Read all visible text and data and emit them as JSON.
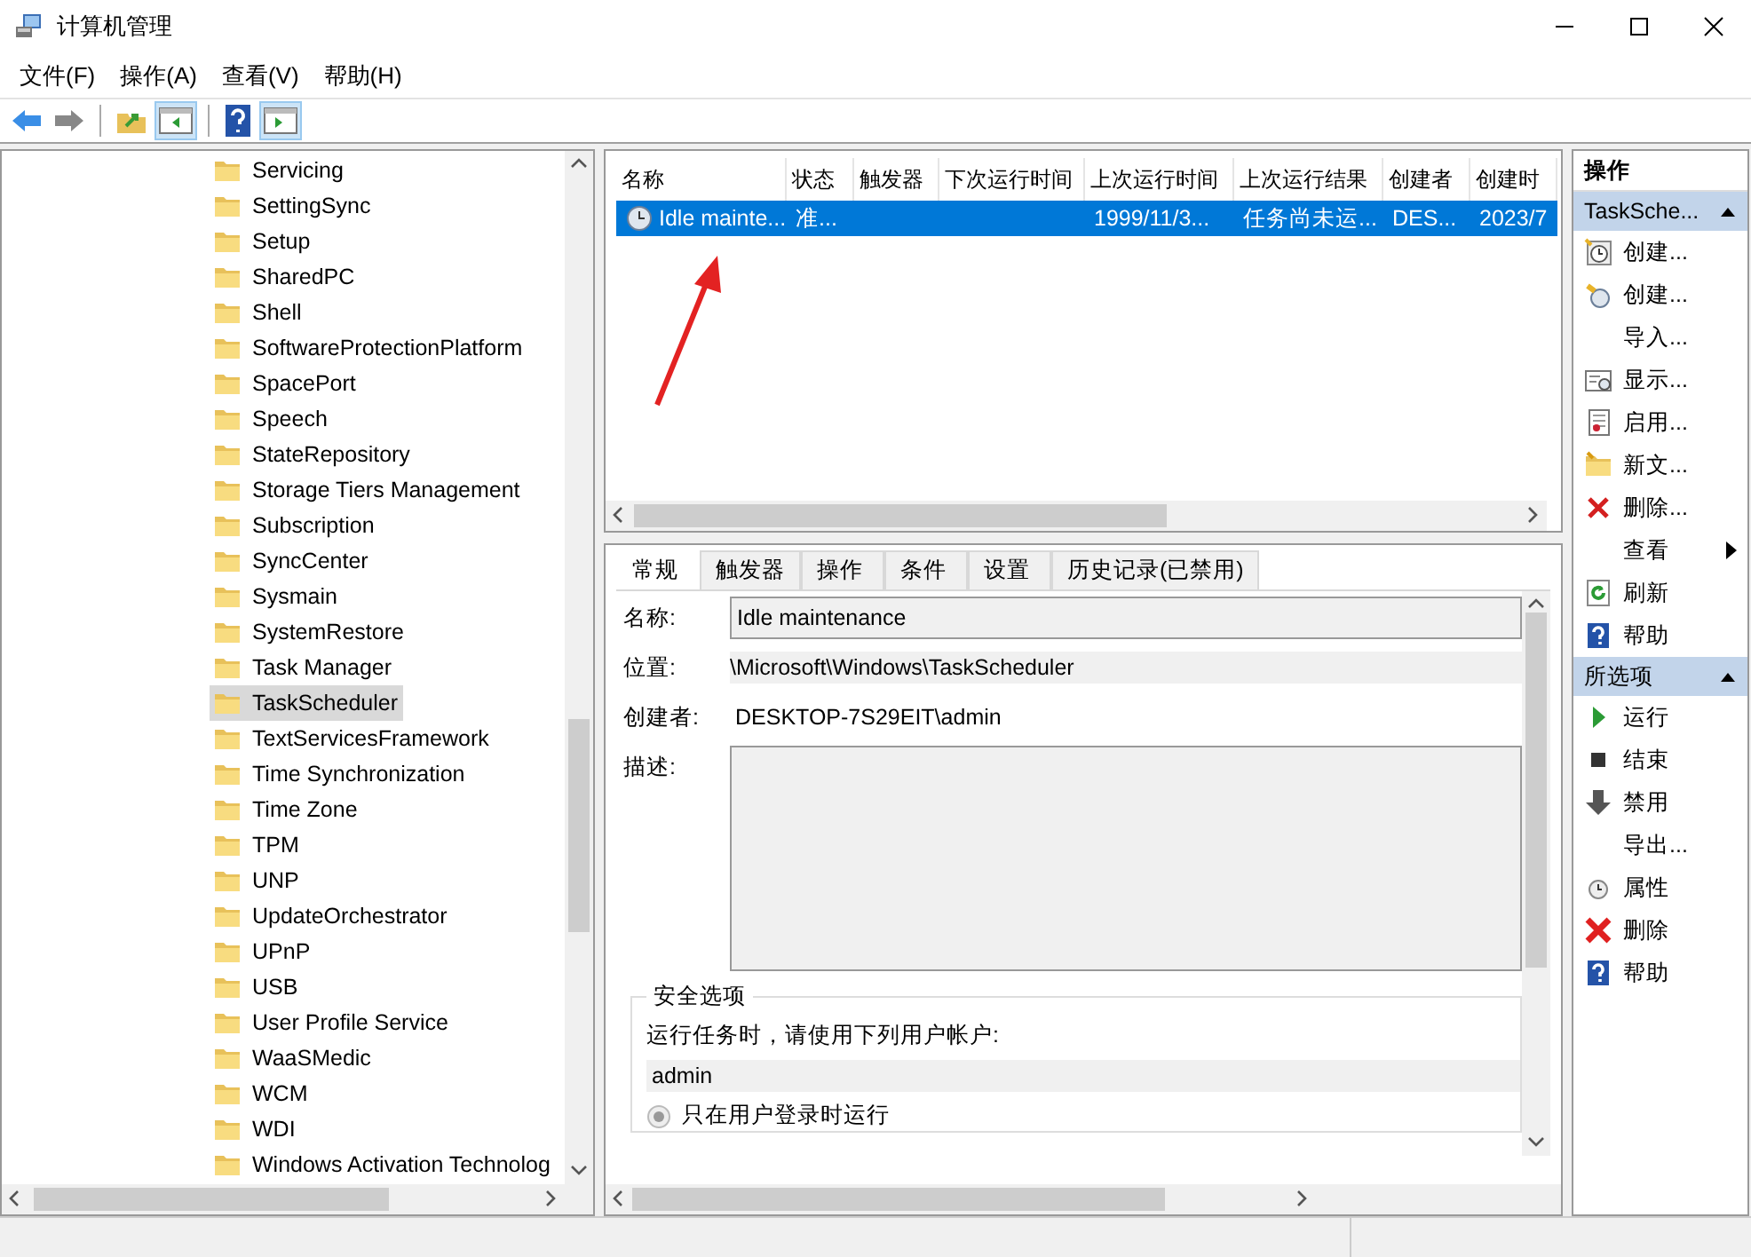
{
  "window": {
    "title": "计算机管理"
  },
  "menu": [
    "文件(F)",
    "操作(A)",
    "查看(V)",
    "帮助(H)"
  ],
  "tree": {
    "items": [
      {
        "label": "Servicing",
        "selected": false
      },
      {
        "label": "SettingSync",
        "selected": false
      },
      {
        "label": "Setup",
        "selected": false
      },
      {
        "label": "SharedPC",
        "selected": false
      },
      {
        "label": "Shell",
        "selected": false
      },
      {
        "label": "SoftwareProtectionPlatform",
        "selected": false
      },
      {
        "label": "SpacePort",
        "selected": false
      },
      {
        "label": "Speech",
        "selected": false
      },
      {
        "label": "StateRepository",
        "selected": false
      },
      {
        "label": "Storage Tiers Management",
        "selected": false
      },
      {
        "label": "Subscription",
        "selected": false
      },
      {
        "label": "SyncCenter",
        "selected": false
      },
      {
        "label": "Sysmain",
        "selected": false
      },
      {
        "label": "SystemRestore",
        "selected": false
      },
      {
        "label": "Task Manager",
        "selected": false
      },
      {
        "label": "TaskScheduler",
        "selected": true
      },
      {
        "label": "TextServicesFramework",
        "selected": false
      },
      {
        "label": "Time Synchronization",
        "selected": false
      },
      {
        "label": "Time Zone",
        "selected": false
      },
      {
        "label": "TPM",
        "selected": false
      },
      {
        "label": "UNP",
        "selected": false
      },
      {
        "label": "UpdateOrchestrator",
        "selected": false
      },
      {
        "label": "UPnP",
        "selected": false
      },
      {
        "label": "USB",
        "selected": false
      },
      {
        "label": "User Profile Service",
        "selected": false
      },
      {
        "label": "WaaSMedic",
        "selected": false
      },
      {
        "label": "WCM",
        "selected": false
      },
      {
        "label": "WDI",
        "selected": false
      },
      {
        "label": "Windows Activation Technolog",
        "selected": false
      }
    ]
  },
  "task_table": {
    "columns": [
      "名称",
      "状态",
      "触发器",
      "下次运行时间",
      "上次运行时间",
      "上次运行结果",
      "创建者",
      "创建时"
    ],
    "rows": [
      {
        "cells": [
          "Idle mainte...",
          "准...",
          "",
          "",
          "1999/11/3...",
          "任务尚未运...",
          "DES...",
          "2023/7"
        ],
        "selected": true
      }
    ]
  },
  "detail_tabs": [
    {
      "label": "常规",
      "selected": true
    },
    {
      "label": "触发器",
      "selected": false
    },
    {
      "label": "操作",
      "selected": false
    },
    {
      "label": "条件",
      "selected": false
    },
    {
      "label": "设置",
      "selected": false
    },
    {
      "label": "历史记录(已禁用)",
      "selected": false
    }
  ],
  "general": {
    "name_label": "名称:",
    "name_value": "Idle maintenance",
    "location_label": "位置:",
    "location_value": "\\Microsoft\\Windows\\TaskScheduler",
    "author_label": "创建者:",
    "author_value": "DESKTOP-7S29EIT\\admin",
    "description_label": "描述:"
  },
  "security": {
    "title": "安全选项",
    "prompt": "运行任务时，请使用下列用户帐户:",
    "user": "admin",
    "options": [
      {
        "label": "只在用户登录时运行",
        "selected": true
      }
    ]
  },
  "actions": {
    "title": "操作",
    "sections": [
      {
        "title": "TaskSche...",
        "expanded": true,
        "items": [
          {
            "label": "创建...",
            "kind": "plain"
          },
          {
            "label": "创建...",
            "kind": "plain"
          },
          {
            "label": "导入...",
            "kind": "plain"
          },
          {
            "label": "显示...",
            "kind": "plain"
          },
          {
            "label": "启用...",
            "kind": "plain"
          },
          {
            "label": "新文...",
            "kind": "plain"
          },
          {
            "label": "删除...",
            "kind": "plain"
          },
          {
            "label": "查看",
            "kind": "submenu"
          },
          {
            "label": "刷新",
            "kind": "plain"
          },
          {
            "label": "帮助",
            "kind": "plain"
          }
        ]
      },
      {
        "title": "所选项",
        "expanded": true,
        "items": [
          {
            "label": "运行",
            "kind": "plain"
          },
          {
            "label": "结束",
            "kind": "plain"
          },
          {
            "label": "禁用",
            "kind": "plain"
          },
          {
            "label": "导出...",
            "kind": "plain"
          },
          {
            "label": "属性",
            "kind": "plain"
          },
          {
            "label": "删除",
            "kind": "plain"
          },
          {
            "label": "帮助",
            "kind": "plain"
          }
        ]
      }
    ]
  }
}
